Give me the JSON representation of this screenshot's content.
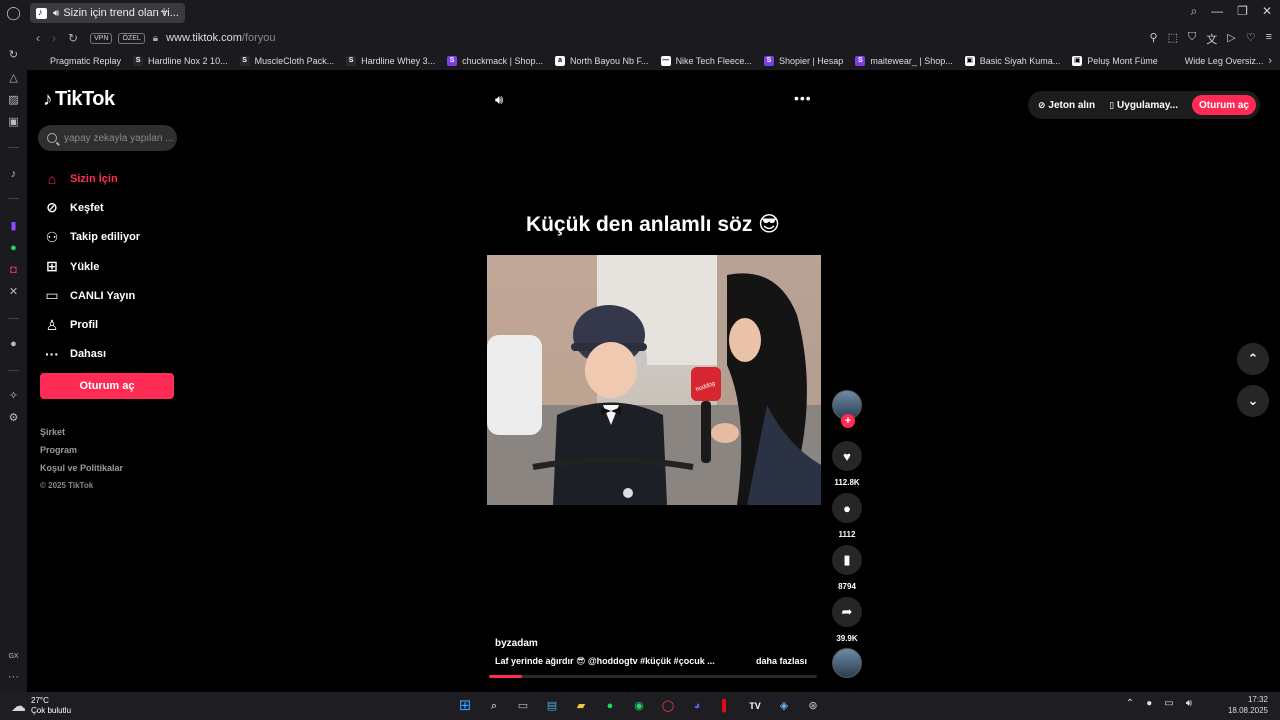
{
  "browser": {
    "tab_title": "Sizin için trend olan vi...",
    "url_main": "www.tiktok.com",
    "url_path": "/foryou",
    "vpn_label": "VPN",
    "private_label": "ÖZEL",
    "bookmarks": [
      {
        "label": "Pragmatic Replay",
        "icon": "",
        "color": "#1b1b1f"
      },
      {
        "label": "Hardline Nox 2 10...",
        "icon": "S",
        "color": "#2a2a2a"
      },
      {
        "label": "MuscleCloth Pack...",
        "icon": "S",
        "color": "#2a2a2a"
      },
      {
        "label": "Hardline Whey 3...",
        "icon": "S",
        "color": "#2a2a2a"
      },
      {
        "label": "chuckmack | Shop...",
        "icon": "S",
        "color": "#7b3fe4"
      },
      {
        "label": "North Bayou Nb F...",
        "icon": "a",
        "color": "#ffffff"
      },
      {
        "label": "Nike Tech Fleece...",
        "icon": "—",
        "color": "#ffffff"
      },
      {
        "label": "Shopier | Hesap",
        "icon": "S",
        "color": "#7b3fe4"
      },
      {
        "label": "maitewear_ | Shop...",
        "icon": "S",
        "color": "#7b3fe4"
      },
      {
        "label": "Basic Siyah Kuma...",
        "icon": "▣",
        "color": "#ffffff"
      },
      {
        "label": "Peluş Mont Füme",
        "icon": "▣",
        "color": "#ffffff"
      },
      {
        "label": "Wide Leg Oversiz...",
        "icon": "",
        "color": "#1b1b1f"
      }
    ]
  },
  "tiktok": {
    "logo": "TikTok",
    "search_placeholder": "yapay zekayla yapılan ...",
    "menu": [
      {
        "label": "Sizin İçin",
        "icon": "home-icon",
        "glyph": "⌂",
        "active": true
      },
      {
        "label": "Keşfet",
        "icon": "compass-icon",
        "glyph": "⊘",
        "active": false
      },
      {
        "label": "Takip ediliyor",
        "icon": "following-icon",
        "glyph": "⚇",
        "active": false
      },
      {
        "label": "Yükle",
        "icon": "upload-icon",
        "glyph": "⊞",
        "active": false
      },
      {
        "label": "CANLI Yayın",
        "icon": "live-icon",
        "glyph": "▭",
        "active": false
      },
      {
        "label": "Profil",
        "icon": "profile-icon",
        "glyph": "♙",
        "active": false
      },
      {
        "label": "Dahası",
        "icon": "more-dots-icon",
        "glyph": "···",
        "active": false
      }
    ],
    "login_button": "Oturum aç",
    "footer": {
      "company": "Şirket",
      "program": "Program",
      "terms": "Koşul ve Politikalar",
      "copyright": "© 2025 TikTok"
    },
    "top_right": {
      "coins": "Jeton alın",
      "app": "Uygulamay...",
      "login": "Oturum aç"
    },
    "video": {
      "caption": "Küçük den anlamlı söz 😎",
      "author": "byzadam",
      "description": "Laf yerinde ağırdır 😎 @hoddogtv #küçük #çocuk ...",
      "more_label": "daha fazlası",
      "mic_brand": "hoddog",
      "progress_fraction": 0.1
    },
    "actions": {
      "likes": "112.8K",
      "comments": "1112",
      "saves": "8794",
      "shares": "39.9K"
    }
  },
  "taskbar": {
    "temperature": "27°C",
    "weather": "Çok bulutlu",
    "time": "17:32",
    "date": "18.08.2025"
  }
}
